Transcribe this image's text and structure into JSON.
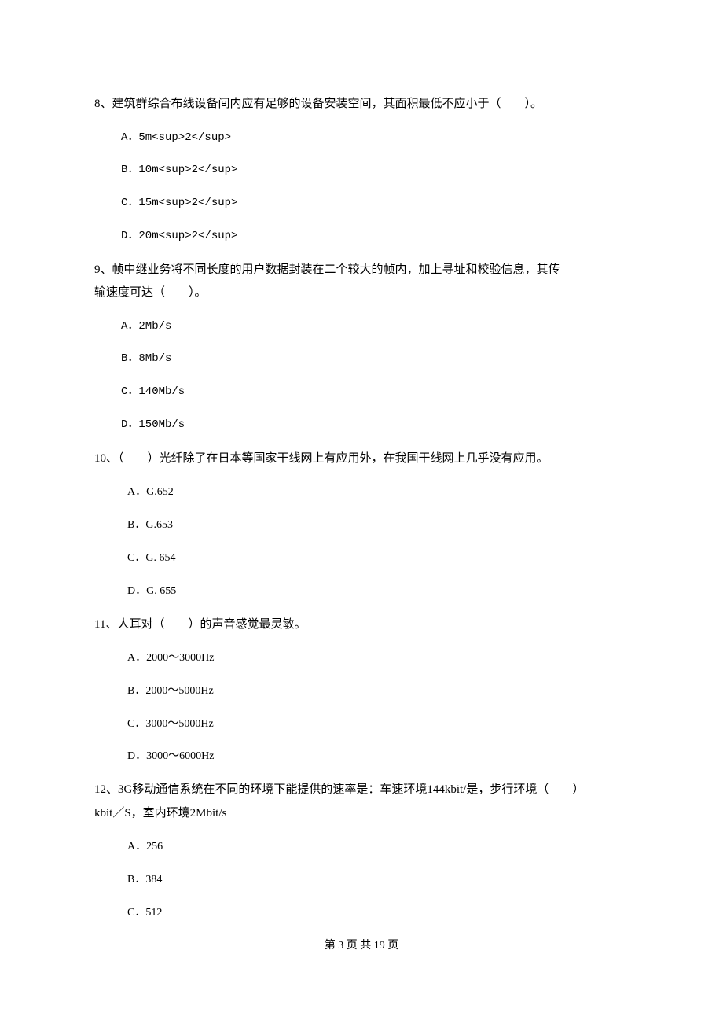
{
  "q8": {
    "text": "8、建筑群综合布线设备间内应有足够的设备安装空间，其面积最低不应小于（　　）。",
    "A": "A．5m<sup>2</sup>",
    "B": "B．10m<sup>2</sup>",
    "C": "C．15m<sup>2</sup>",
    "D": "D．20m<sup>2</sup>"
  },
  "q9": {
    "line1": "9、帧中继业务将不同长度的用户数据封装在二个较大的帧内，加上寻址和校验信息，其传",
    "line2": "输速度可达（　　）。",
    "A": "A．2Mb/s",
    "B": "B．8Mb/s",
    "C": "C．140Mb/s",
    "D": "D．150Mb/s"
  },
  "q10": {
    "text": "10、（　　）光纤除了在日本等国家干线网上有应用外，在我国干线网上几乎没有应用。",
    "A": "A．G.652",
    "B": "B．G.653",
    "C": "C．G. 654",
    "D": "D．G. 655"
  },
  "q11": {
    "text": "11、人耳对（　　）的声音感觉最灵敏。",
    "A": "A．2000～3000Hz",
    "B": "B．2000～5000Hz",
    "C": "C．3000～5000Hz",
    "D": "D．3000～6000Hz"
  },
  "q12": {
    "line1": "12、3G移动通信系统在不同的环境下能提供的速率是：车速环境144kbit/是，步行环境（　　）",
    "line2": "kbit／S，室内环境2Mbit/s",
    "A": "A．256",
    "B": "B．384",
    "C": "C．512"
  },
  "footer": "第 3 页 共 19 页"
}
